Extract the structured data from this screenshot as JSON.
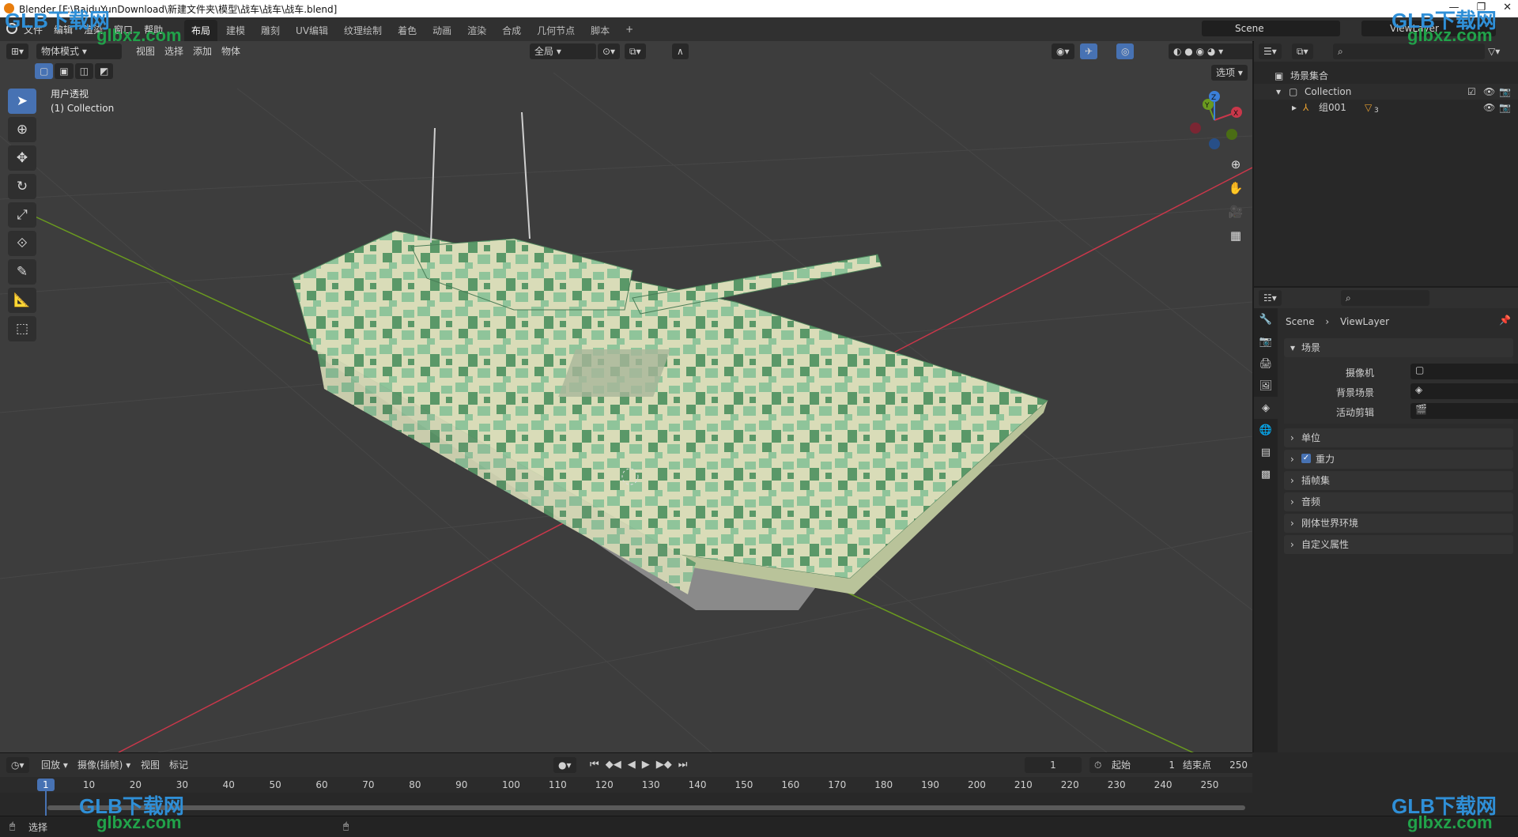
{
  "window": {
    "title": "Blender [F:\\BaiduYunDownload\\新建文件夹\\模型\\战车\\战车\\战车.blend]",
    "controls": [
      "—",
      "❐",
      "✕"
    ]
  },
  "menu": [
    "文件",
    "编辑",
    "渲染",
    "窗口",
    "帮助"
  ],
  "workspaces": [
    "布局",
    "建模",
    "雕刻",
    "UV编辑",
    "纹理绘制",
    "着色",
    "动画",
    "渲染",
    "合成",
    "几何节点",
    "脚本",
    "+"
  ],
  "active_workspace": "布局",
  "scene": "Scene",
  "view_layer": "ViewLayer",
  "viewport": {
    "mode": "物体模式",
    "menus": [
      "视图",
      "选择",
      "添加",
      "物体"
    ],
    "orientation": "全局",
    "options": "选项",
    "view_name": "用户透视",
    "collection_label": "(1) Collection",
    "gizmo_axes": [
      "X",
      "Y",
      "Z"
    ],
    "tools": [
      "select-box",
      "cursor",
      "move",
      "rotate",
      "scale",
      "transform",
      "annotate",
      "measure",
      "add-cube"
    ]
  },
  "outliner": {
    "root": "场景集合",
    "collection": "Collection",
    "object": "组001",
    "object_badge": "3"
  },
  "properties": {
    "breadcrumb": [
      "Scene",
      "ViewLayer"
    ],
    "scene_panel": "场景",
    "camera_label": "摄像机",
    "background_label": "背景场景",
    "clip_label": "活动剪辑",
    "collapsed_panels": [
      "单位",
      "重力",
      "插帧集",
      "音频",
      "刚体世界环境",
      "自定义属性"
    ],
    "gravity_checked": true
  },
  "timeline": {
    "menus": [
      "回放",
      "摄像(插帧)",
      "视图",
      "标记"
    ],
    "current_frame": "1",
    "start_label": "起始",
    "start": "1",
    "end_label": "结束点",
    "end": "250",
    "ticks": [
      "1",
      "10",
      "20",
      "30",
      "40",
      "50",
      "60",
      "70",
      "80",
      "90",
      "100",
      "110",
      "120",
      "130",
      "140",
      "150",
      "160",
      "170",
      "180",
      "190",
      "200",
      "210",
      "220",
      "230",
      "240",
      "250"
    ]
  },
  "status": {
    "left": "选择"
  },
  "watermark": {
    "brand": "GLB下载网",
    "url": "glbxz.com"
  },
  "colors": {
    "accent": "#4772b3",
    "x_axis": "#c9374a",
    "y_axis": "#6a9a1f",
    "z_axis": "#3b7fd9",
    "camo_light": "#d9dcb8",
    "camo_mid": "#8fc49a",
    "camo_dark": "#5a9868"
  }
}
